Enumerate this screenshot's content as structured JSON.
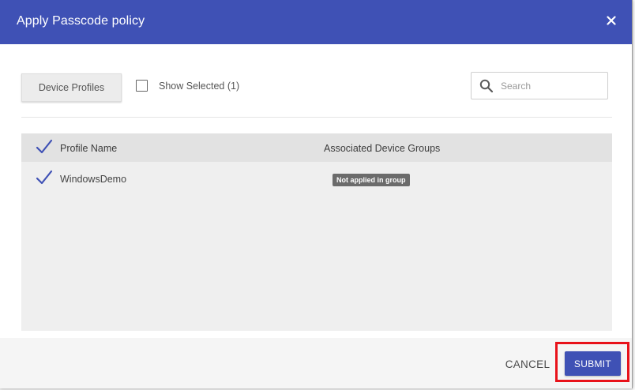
{
  "dialog": {
    "title": "Apply Passcode policy",
    "close_icon": "close-icon"
  },
  "toolbar": {
    "device_profiles_label": "Device Profiles",
    "show_selected_label": "Show Selected (1)",
    "show_selected_checked": false,
    "search_placeholder": "Search",
    "search_value": ""
  },
  "table": {
    "columns": [
      "Profile Name",
      "Associated Device Groups"
    ],
    "header_checked": true,
    "rows": [
      {
        "selected": true,
        "profile_name": "WindowsDemo",
        "device_groups_badge": "Not applied in group"
      }
    ]
  },
  "footer": {
    "cancel_label": "CANCEL",
    "submit_label": "SUBMIT"
  },
  "colors": {
    "primary": "#3f51b5",
    "highlight": "#e8121a",
    "badge": "#6b6b6b"
  }
}
